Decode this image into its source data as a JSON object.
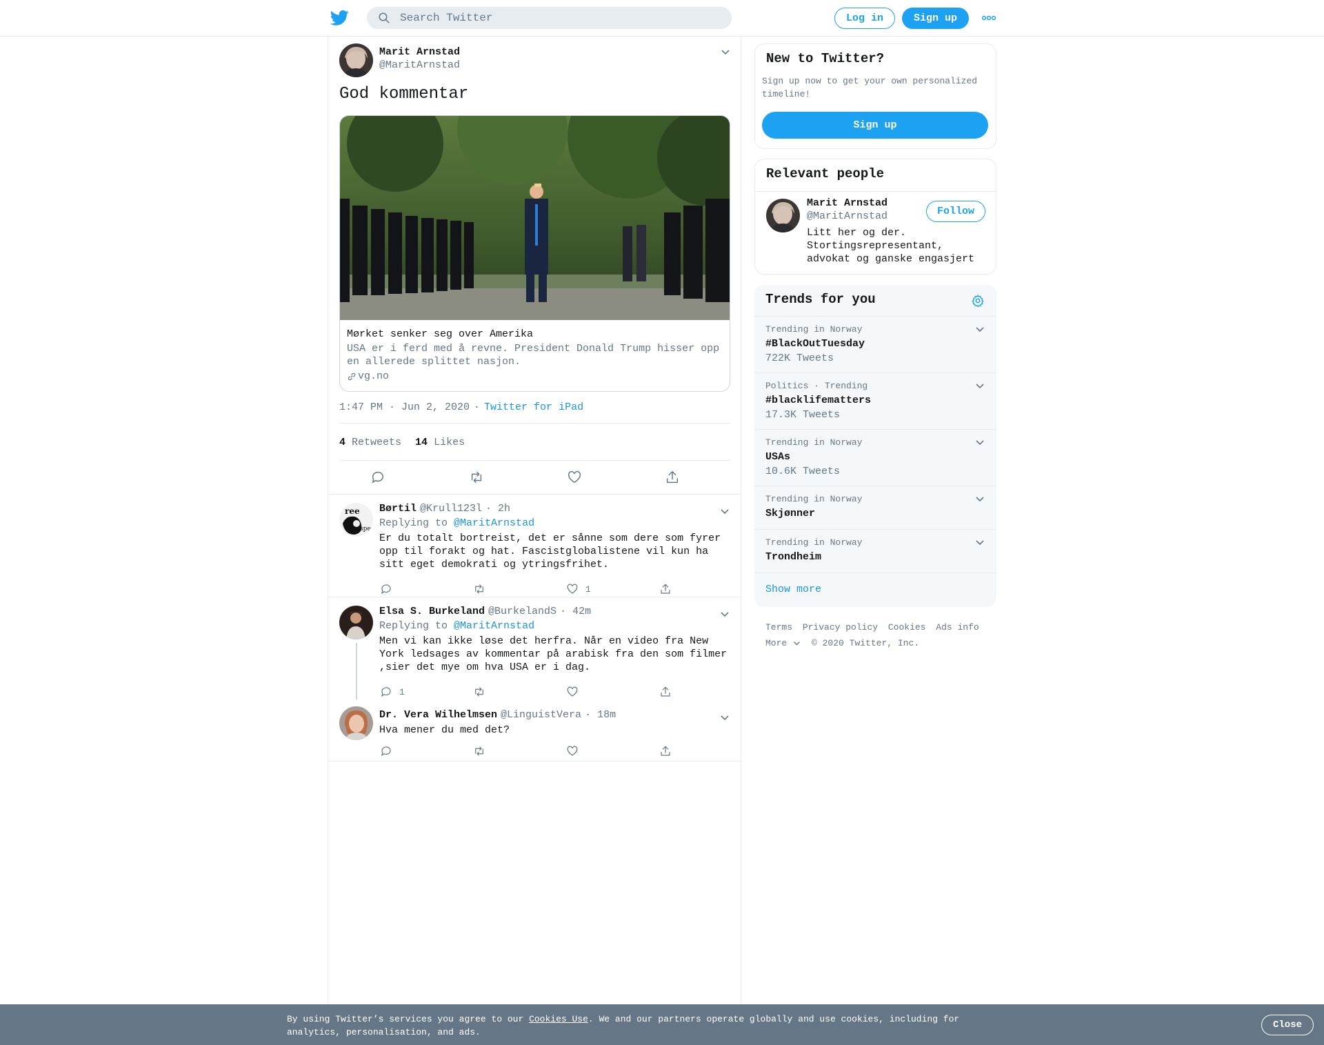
{
  "header": {
    "search_placeholder": "Search Twitter",
    "login_label": "Log in",
    "signup_label": "Sign up"
  },
  "tweet": {
    "author_name": "Marit Arnstad",
    "author_handle": "@MaritArnstad",
    "text": "God kommentar",
    "card": {
      "title": "Mørket senker seg over Amerika",
      "description": "USA er i ferd med å revne. President Donald Trump hisser opp en allerede splittet nasjon.",
      "domain": "vg.no"
    },
    "timestamp": "1:47 PM · Jun 2, 2020",
    "separator": "·",
    "source": "Twitter for iPad",
    "retweets_count": "4",
    "retweets_label": "Retweets",
    "likes_count": "14",
    "likes_label": "Likes"
  },
  "replies": [
    {
      "name": "Børtil",
      "handle": "@Krull123l",
      "time": "· 2h",
      "replying_prefix": "Replying to",
      "replying_to": "@MaritArnstad",
      "text": "Er du totalt bortreist, det er sånne som dere som fyrer opp til forakt og hat. Fascistglobalistene vil kun ha sitt eget demokrati og ytringsfrihet.",
      "like_count": "1",
      "reply_count": ""
    },
    {
      "name": "Elsa S. Burkeland",
      "handle": "@BurkelandS",
      "time": "· 42m",
      "replying_prefix": "Replying to",
      "replying_to": "@MaritArnstad",
      "text": "Men vi kan ikke løse det herfra. Når en video fra New York ledsages av kommentar på arabisk fra den som filmer ,sier det mye om hva USA er i dag.",
      "like_count": "",
      "reply_count": "1"
    },
    {
      "name": "Dr. Vera Wilhelmsen",
      "handle": "@LinguistVera",
      "time": "· 18m",
      "text": "Hva mener du med det?",
      "like_count": "",
      "reply_count": ""
    }
  ],
  "sidebar": {
    "new_title": "New to Twitter?",
    "new_desc": "Sign up now to get your own personalized timeline!",
    "signup_label": "Sign up",
    "relevant_title": "Relevant people",
    "person_name": "Marit Arnstad",
    "person_handle": "@MaritArnstad",
    "person_bio": "Litt her og der. Stortingsrepresentant, advokat og ganske engasjert",
    "follow_label": "Follow",
    "trends_title": "Trends for you",
    "trends": [
      {
        "context": "Trending in Norway",
        "topic": "#BlackOutTuesday",
        "count": "722K Tweets"
      },
      {
        "context": "Politics · Trending",
        "topic": "#blacklifematters",
        "count": "17.3K Tweets"
      },
      {
        "context": "Trending in Norway",
        "topic": "USAs",
        "count": "10.6K Tweets"
      },
      {
        "context": "Trending in Norway",
        "topic": "Skjønner",
        "count": ""
      },
      {
        "context": "Trending in Norway",
        "topic": "Trondheim",
        "count": ""
      }
    ],
    "show_more": "Show more",
    "footer": [
      "Terms",
      "Privacy policy",
      "Cookies",
      "Ads info",
      "More",
      "© 2020 Twitter, Inc."
    ]
  },
  "cookie_bar": {
    "prefix": "By using Twitter’s services you agree to our ",
    "link": "Cookies Use",
    "suffix": ". We and our partners operate globally and use cookies, including for analytics, personalisation, and ads.",
    "close_label": "Close"
  },
  "colors": {
    "accent": "#1da1f2",
    "link": "#1b95e0",
    "secondary_text": "#657786",
    "border": "#e6ecf0",
    "cookie_bg": "#657786"
  }
}
